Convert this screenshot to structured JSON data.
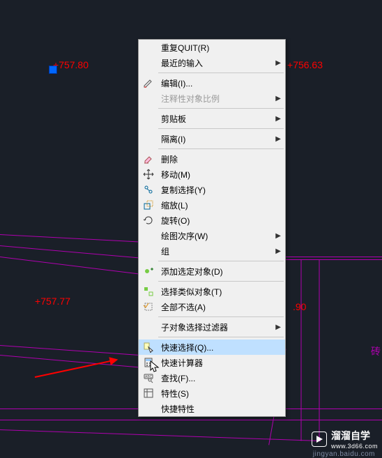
{
  "canvas": {
    "elevations": {
      "top_left": "757.80",
      "top_right": "756.63",
      "mid_left": "757.77",
      "mid_right": ".90"
    },
    "right_char": "砖"
  },
  "menu": {
    "repeat": "重复QUIT(R)",
    "recent": "最近的输入",
    "edit": "编辑(I)...",
    "anno_scale": "注释性对象比例",
    "clipboard": "剪贴板",
    "isolate": "隔离(I)",
    "erase": "删除",
    "move": "移动(M)",
    "copysel": "复制选择(Y)",
    "scale": "缩放(L)",
    "rotate": "旋转(O)",
    "draworder": "绘图次序(W)",
    "group": "组",
    "addsel": "添加选定对象(D)",
    "selsim": "选择类似对象(T)",
    "selnone": "全部不选(A)",
    "subfilter": "子对象选择过滤器",
    "qselect": "快速选择(Q)...",
    "qcalc": "快速计算器",
    "find": "查找(F)...",
    "props": "特性(S)",
    "qprops": "快捷特性"
  },
  "watermark": {
    "brand": "溜溜自学",
    "url": "www.3d66.com"
  }
}
